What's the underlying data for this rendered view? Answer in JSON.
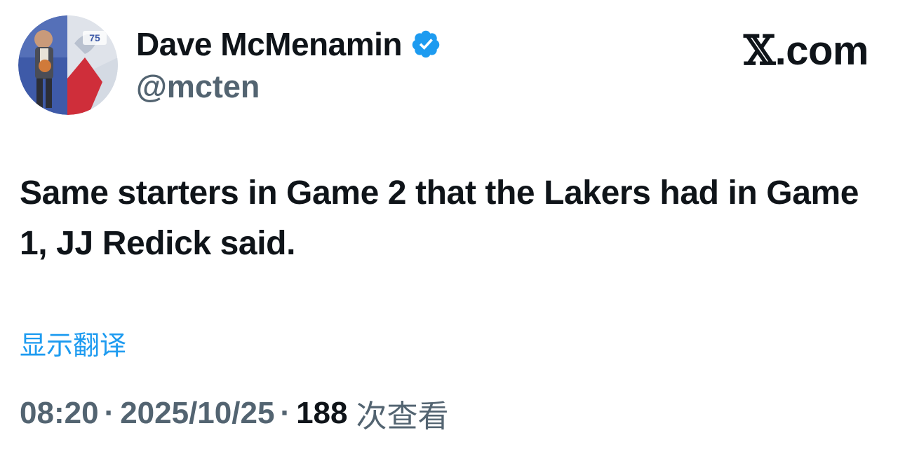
{
  "author": {
    "name": "Dave McMenamin",
    "handle": "@mcten",
    "verified": true,
    "avatar_badge_text": "75"
  },
  "watermark": {
    "x_glyph": "𝕏",
    "suffix": ".com"
  },
  "tweet": {
    "text": "Same starters in Game 2 that the Lakers had in Game 1, JJ Redick said.",
    "translate_label": "显示翻译"
  },
  "meta": {
    "time": "08:20",
    "date": "2025/10/25",
    "separator": "·",
    "views_count": "188",
    "views_label": "次查看"
  },
  "colors": {
    "text_primary": "#0f1419",
    "text_secondary": "#536471",
    "link": "#1d9bf0",
    "verified_badge": "#1d9bf0"
  }
}
